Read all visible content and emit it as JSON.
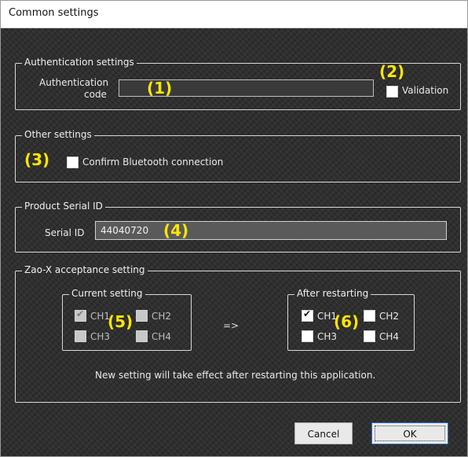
{
  "window": {
    "title": "Common settings"
  },
  "auth": {
    "legend": "Authentication settings",
    "code_label_line1": "Authentication",
    "code_label_line2": "code",
    "code_value": "",
    "validation_label": "Validation",
    "validation_checked": false
  },
  "other": {
    "legend": "Other settings",
    "bluetooth_label": "Confirm Bluetooth connection",
    "bluetooth_checked": false
  },
  "serial": {
    "legend": "Product Serial ID",
    "label": "Serial ID",
    "value": "44040720"
  },
  "zao": {
    "legend": "Zao-X acceptance setting",
    "current": {
      "legend": "Current setting",
      "channels": [
        {
          "label": "CH1",
          "checked": true,
          "disabled": true
        },
        {
          "label": "CH2",
          "checked": false,
          "disabled": true
        },
        {
          "label": "CH3",
          "checked": false,
          "disabled": true
        },
        {
          "label": "CH4",
          "checked": false,
          "disabled": true
        }
      ]
    },
    "arrow": "=>",
    "after": {
      "legend": "After restarting",
      "channels": [
        {
          "label": "CH1",
          "checked": true
        },
        {
          "label": "CH2",
          "checked": false
        },
        {
          "label": "CH3",
          "checked": false
        },
        {
          "label": "CH4",
          "checked": false
        }
      ]
    },
    "note": "New setting will take effect after restarting this application."
  },
  "buttons": {
    "cancel": "Cancel",
    "ok": "OK"
  },
  "annotations": [
    "(1)",
    "(2)",
    "(3)",
    "(4)",
    "(5)",
    "(6)"
  ],
  "colors": {
    "annotation": "#ffe600",
    "background": "#2f2f2f"
  }
}
